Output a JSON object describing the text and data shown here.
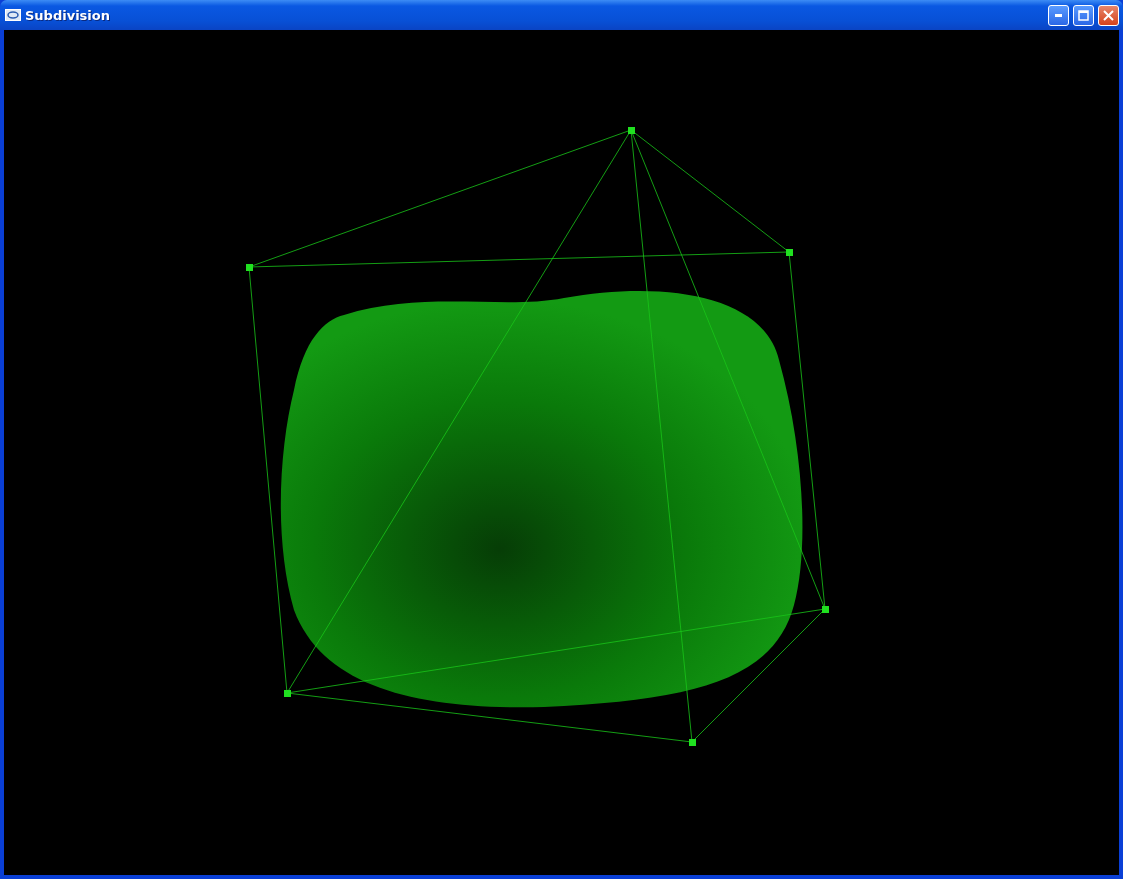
{
  "window": {
    "title": "Subdivision"
  }
}
